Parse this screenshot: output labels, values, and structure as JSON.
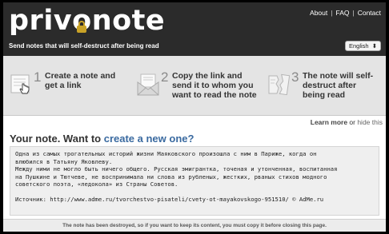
{
  "header": {
    "logo_before": "priv",
    "logo_o": "o",
    "logo_after": "note",
    "tagline": "Send notes that will self-destruct after being read",
    "nav": [
      "About",
      "FAQ",
      "Contact"
    ],
    "language": "English"
  },
  "steps": [
    {
      "number": "1",
      "text": "Create a note and get a link",
      "icon": "note-hand-cursor-icon"
    },
    {
      "number": "2",
      "text": "Copy the link and send it to whom you want to read the note",
      "icon": "envelope-icon"
    },
    {
      "number": "3",
      "text": "The note will self-destruct after being read",
      "icon": "torn-note-icon"
    }
  ],
  "learn": {
    "more": "Learn more",
    "or": " or ",
    "hide": "hide this"
  },
  "title": {
    "prefix": "Your note. Want to ",
    "link": "create a new one?"
  },
  "note": {
    "line1": "Одна из самых трогательных историй жизни Маяковского произошла с ним в Париже, когда он",
    "line2": "влюбился в Татьяну Яковлеву.",
    "line3": "Между ними не могло быть ничего общего. Русская эмигрантка, точеная и утонченная, воспитанная",
    "line4": "на Пушкине и Тютчеве, не воспринимала ни слова из рубленых, жестких, рваных стихов модного",
    "line5": "советского поэта, «ледокола» из Страны Советов.",
    "source": "Источник: http://www.adme.ru/tvorchestvo-pisateli/cvety-ot-mayakovskogo-951510/ © AdMe.ru"
  },
  "footer": "The note has been destroyed, so if you want to keep its content, you must copy it before closing this page.",
  "colors": {
    "header_bg": "#2b2b2b",
    "steps_bg": "#e4e4e4",
    "link": "#3a6aa0",
    "lock": "#c9a227"
  }
}
